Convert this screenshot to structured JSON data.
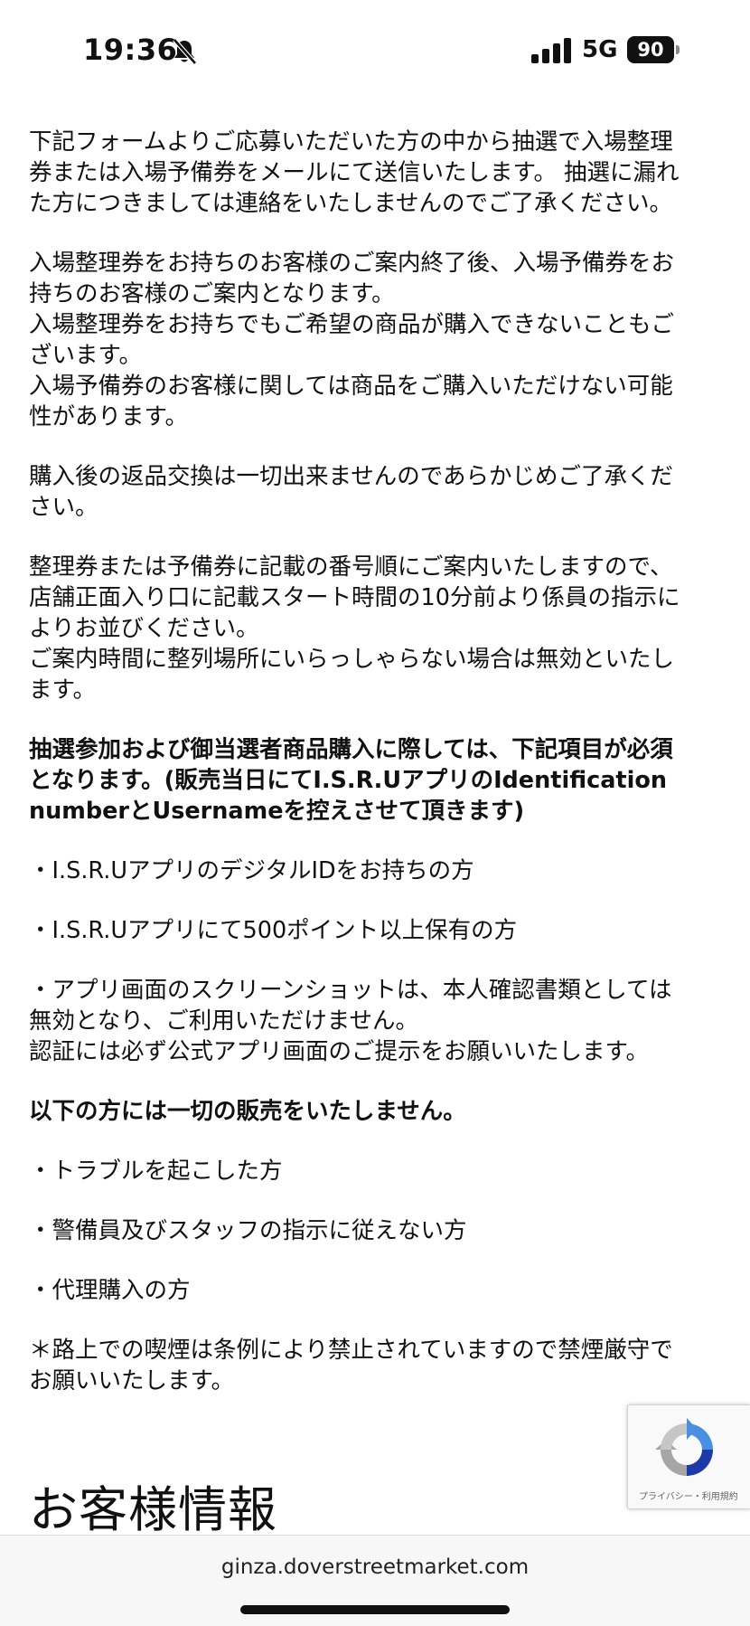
{
  "status_bar": {
    "time": "19:36",
    "network": "5G",
    "battery": "90"
  },
  "content": {
    "p1": [
      "下記フォームよりご応募いただいた方の中から抽選で入場整理",
      "券または入場予備券をメールにて送信いたします。 抽選に漏れ",
      "た方につきましては連絡をいたしませんのでご了承ください。"
    ],
    "p2": [
      "入場整理券をお持ちのお客様のご案内終了後、入場予備券をお",
      "持ちのお客様のご案内となります。",
      "入場整理券をお持ちでもご希望の商品が購入できないこともご",
      "ざいます。",
      "入場予備券のお客様に関しては商品をご購入いただけない可能",
      "性があります。"
    ],
    "p3": [
      "購入後の返品交換は一切出来ませんのであらかじめご了承くだ",
      "さい。"
    ],
    "p4": [
      "整理券または予備券に記載の番号順にご案内いたしますので、",
      "店舗正面入り口に記載スタート時間の10分前より係員の指示に",
      "よりお並びください。",
      "ご案内時間に整列場所にいらっしゃらない場合は無効といたし",
      "ます。"
    ],
    "p5_bold": [
      "抽選参加および御当選者商品購入に際しては、下記項目が必須",
      "となります。(販売当日にてI.S.R.UアプリのIdentification",
      "numberとUsernameを控えさせて頂きます)"
    ],
    "req1": "・I.S.R.UアプリのデジタルIDをお持ちの方",
    "req2": "・I.S.R.Uアプリにて500ポイント以上保有の方",
    "req3": [
      "・アプリ画面のスクリーンショットは、本人確認書類としては",
      "無効となり、ご利用いただけません。",
      "認証には必ず公式アプリ画面のご提示をお願いいたします。"
    ],
    "p6_bold": "以下の方には一切の販売をいたしません。",
    "no1": "・トラブルを起こした方",
    "no2": "・警備員及びスタッフの指示に従えない方",
    "no3": "・代理購入の方",
    "note": [
      "＊路上での喫煙は条例により禁止されていますので禁煙厳守で",
      "お願いいたします。"
    ]
  },
  "section_title": "お客様情報",
  "recaptcha": {
    "links": "プライバシー・利用規約"
  },
  "browser": {
    "url": "ginza.doverstreetmarket.com"
  }
}
